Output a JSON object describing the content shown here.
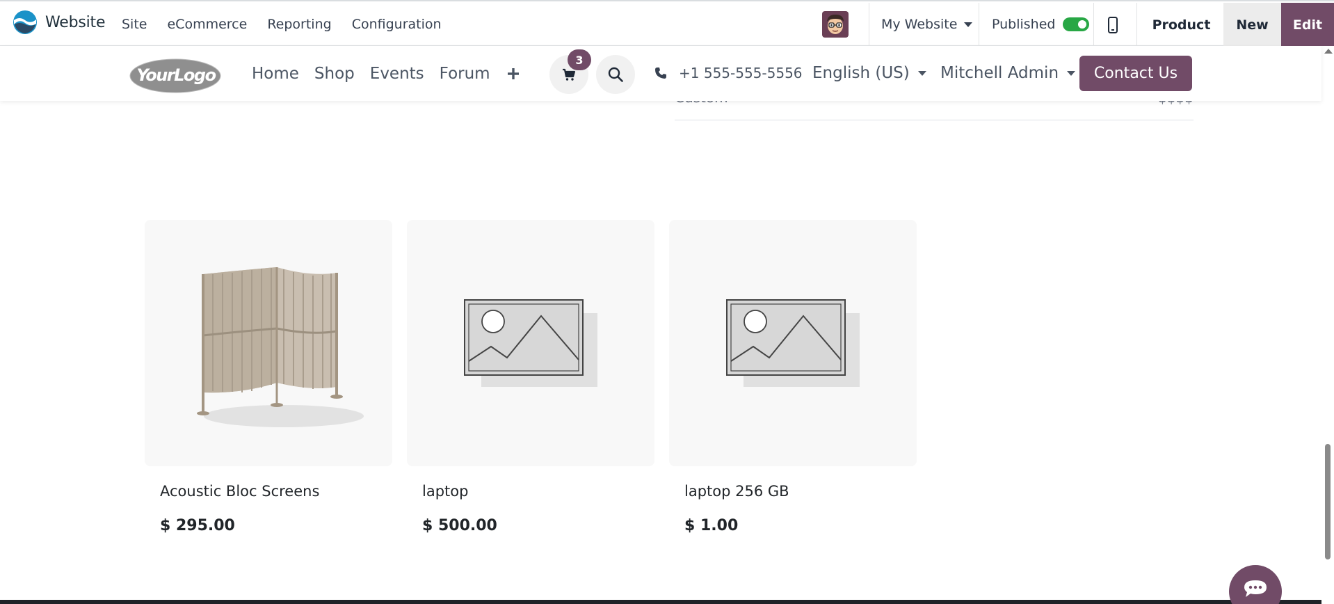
{
  "admin_bar": {
    "app_name": "Website",
    "menu": [
      "Site",
      "eCommerce",
      "Reporting",
      "Configuration"
    ],
    "website_selector": "My Website",
    "published_label": "Published",
    "published": true,
    "product_label": "Product",
    "new_label": "New",
    "edit_label": "Edit"
  },
  "site_header": {
    "logo_text": "YourLogo",
    "nav": [
      "Home",
      "Shop",
      "Events",
      "Forum"
    ],
    "cart_count": "3",
    "phone": "+1 555-555-5556",
    "language": "English (US)",
    "user": "Mitchell Admin",
    "contact_label": "Contact Us"
  },
  "partial_row": {
    "label": "Custom",
    "value": "$$$$"
  },
  "products": [
    {
      "name": "Acoustic Bloc Screens",
      "price": "$ 295.00",
      "image": "acoustic-screen"
    },
    {
      "name": "laptop",
      "price": "$ 500.00",
      "image": "placeholder"
    },
    {
      "name": "laptop 256 GB",
      "price": "$ 1.00",
      "image": "placeholder"
    }
  ],
  "colors": {
    "brand": "#714b67",
    "toggle_on": "#28a745"
  }
}
